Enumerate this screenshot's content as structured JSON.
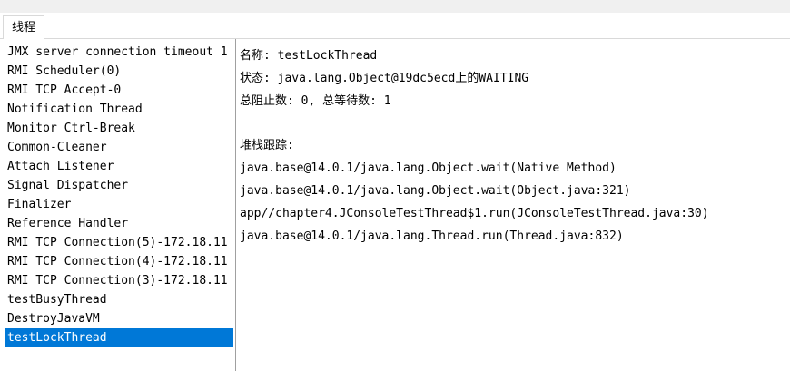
{
  "tabs": [
    {
      "label": "线程"
    }
  ],
  "threads": [
    {
      "name": "JMX server connection timeout 1"
    },
    {
      "name": "RMI Scheduler(0)"
    },
    {
      "name": "RMI TCP Accept-0"
    },
    {
      "name": "Notification Thread"
    },
    {
      "name": "Monitor Ctrl-Break"
    },
    {
      "name": "Common-Cleaner"
    },
    {
      "name": "Attach Listener"
    },
    {
      "name": "Signal Dispatcher"
    },
    {
      "name": "Finalizer"
    },
    {
      "name": "Reference Handler"
    },
    {
      "name": "RMI TCP Connection(5)-172.18.11"
    },
    {
      "name": "RMI TCP Connection(4)-172.18.11"
    },
    {
      "name": "RMI TCP Connection(3)-172.18.11"
    },
    {
      "name": "testBusyThread"
    },
    {
      "name": "DestroyJavaVM"
    },
    {
      "name": "testLockThread",
      "selected": true
    }
  ],
  "details": {
    "name_line": "名称: testLockThread",
    "state_line": "状态: java.lang.Object@19dc5ecd上的WAITING",
    "counts_line": "总阻止数: 0, 总等待数: 1",
    "stack_title": "堆栈跟踪:",
    "stack": [
      "java.base@14.0.1/java.lang.Object.wait(Native Method)",
      "java.base@14.0.1/java.lang.Object.wait(Object.java:321)",
      "app//chapter4.JConsoleTestThread$1.run(JConsoleTestThread.java:30)",
      "java.base@14.0.1/java.lang.Thread.run(Thread.java:832)"
    ]
  },
  "colors": {
    "selection": "#0078d7",
    "selection_text": "#ffffff"
  }
}
